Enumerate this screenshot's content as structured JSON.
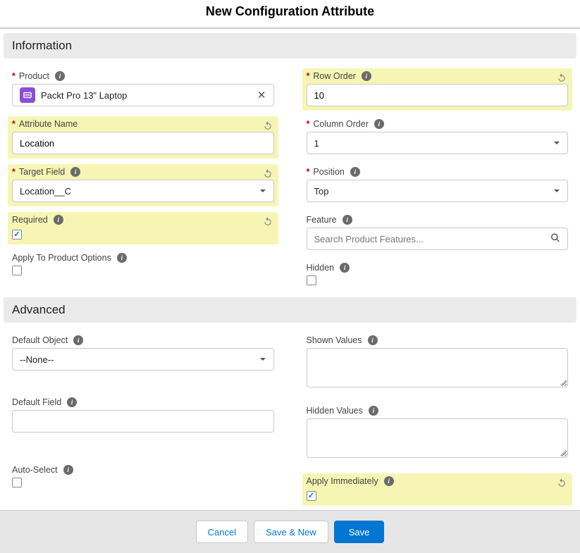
{
  "page_title": "New Configuration Attribute",
  "sections": {
    "information": "Information",
    "advanced": "Advanced"
  },
  "fields": {
    "product": {
      "label": "Product",
      "value": "Packt Pro 13\" Laptop"
    },
    "attribute_name": {
      "label": "Attribute Name",
      "value": "Location"
    },
    "target_field": {
      "label": "Target Field",
      "value": "Location__C"
    },
    "required": {
      "label": "Required",
      "value": true
    },
    "apply_to_product_options": {
      "label": "Apply To Product Options",
      "value": false
    },
    "row_order": {
      "label": "Row Order",
      "value": "10"
    },
    "column_order": {
      "label": "Column Order",
      "value": "1"
    },
    "position": {
      "label": "Position",
      "value": "Top"
    },
    "feature": {
      "label": "Feature",
      "placeholder": "Search Product Features..."
    },
    "hidden": {
      "label": "Hidden",
      "value": false
    },
    "default_object": {
      "label": "Default Object",
      "value": "--None--"
    },
    "default_field": {
      "label": "Default Field",
      "value": ""
    },
    "auto_select": {
      "label": "Auto-Select",
      "value": false
    },
    "shown_values": {
      "label": "Shown Values",
      "value": ""
    },
    "hidden_values": {
      "label": "Hidden Values",
      "value": ""
    },
    "apply_immediately": {
      "label": "Apply Immediately",
      "value": true
    }
  },
  "buttons": {
    "cancel": "Cancel",
    "save_new": "Save & New",
    "save": "Save"
  }
}
